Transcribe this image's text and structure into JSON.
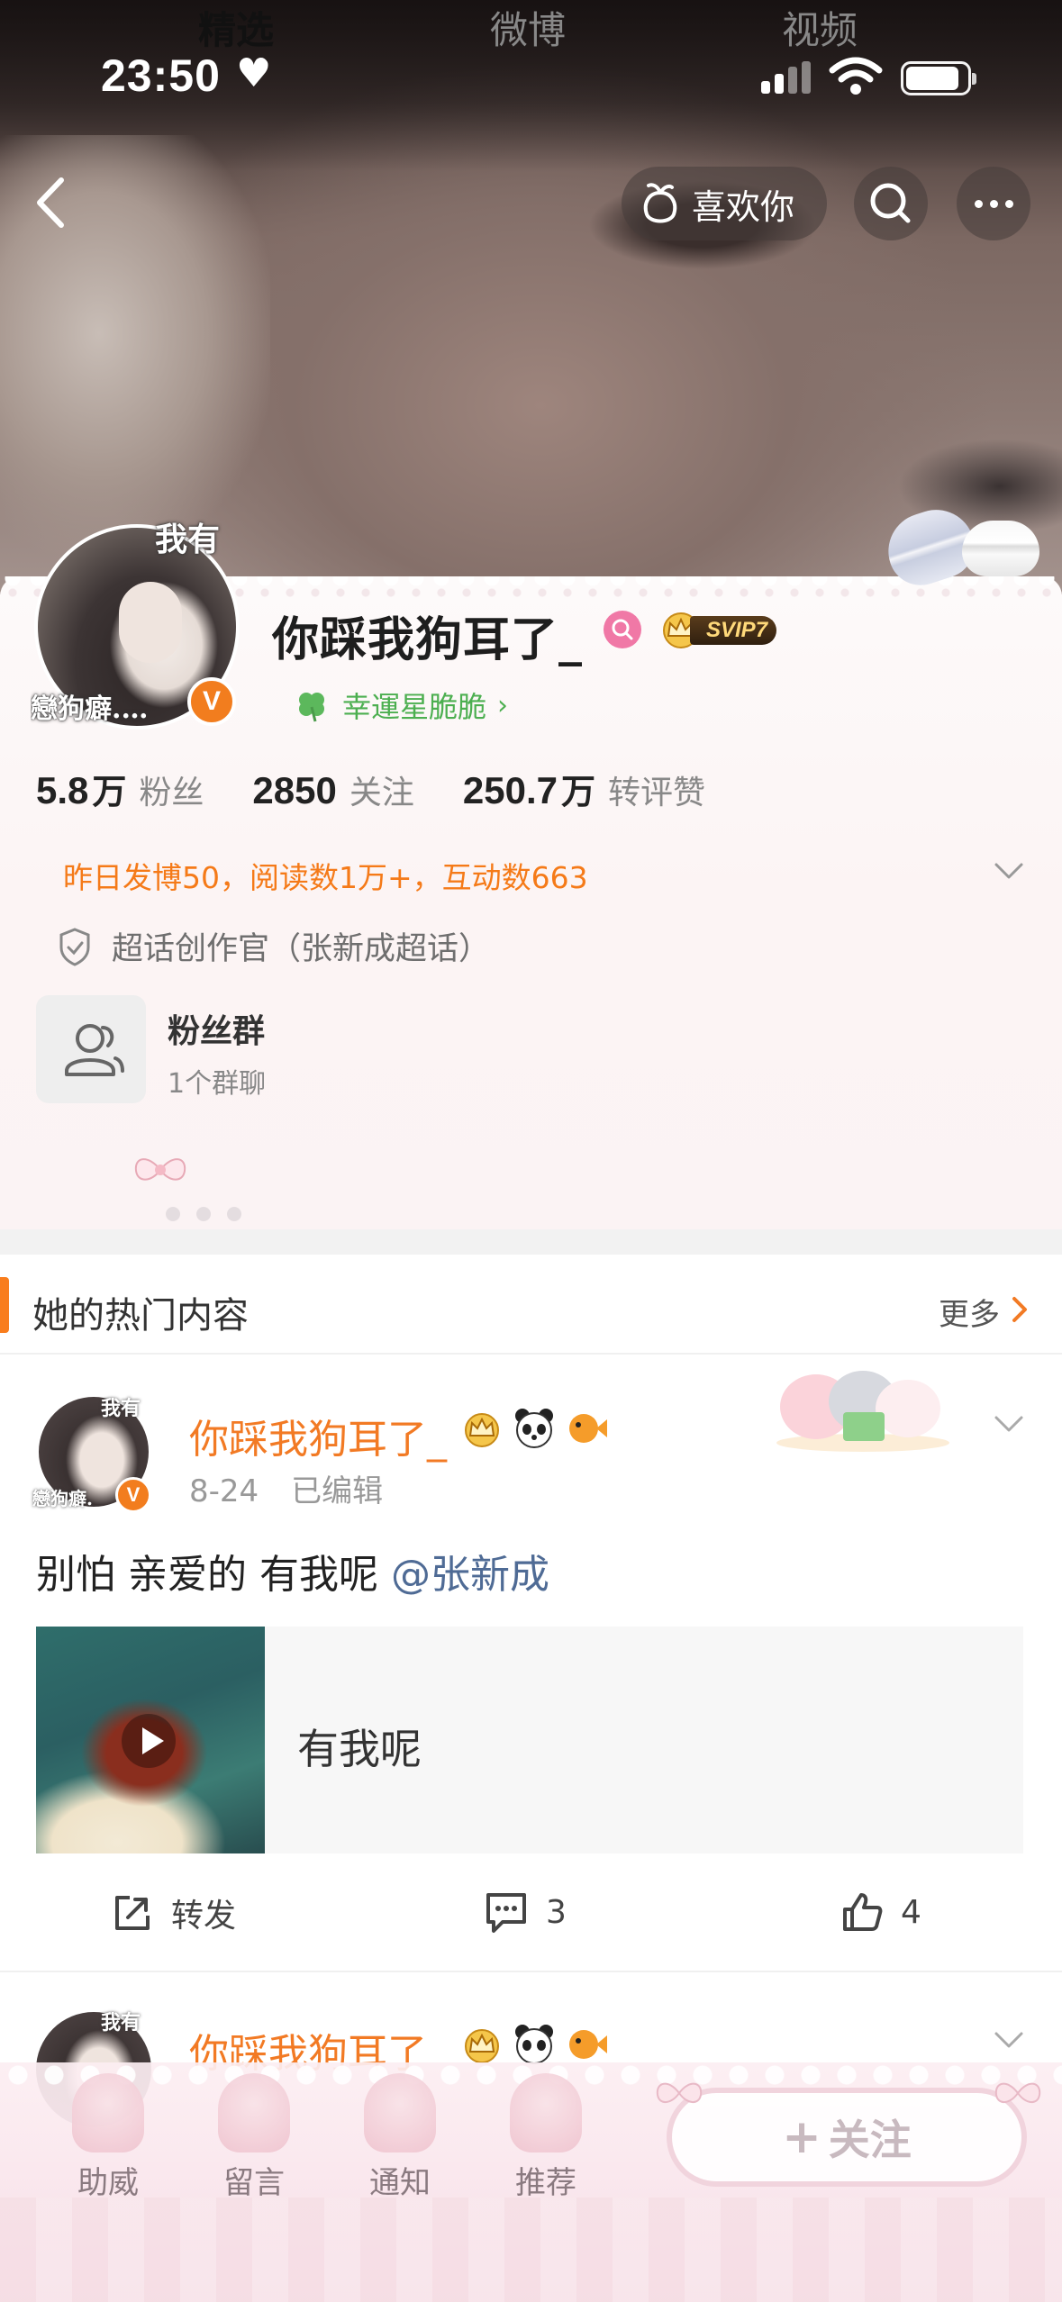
{
  "status_bar": {
    "time": "23:50",
    "heart": "♥",
    "signal": "signal-icon",
    "wifi": "wifi-icon",
    "battery": "battery-icon"
  },
  "top_nav": {
    "back_icon": "chevron-left-icon",
    "like_label": "喜欢你",
    "like_icon": "peach-icon",
    "search_icon": "search-icon",
    "more_icon": "more-icon"
  },
  "profile": {
    "avatar_caption_top": "我有",
    "avatar_caption_bottom": "戀狗癖.…",
    "verified": "V",
    "username": "你踩我狗耳了_",
    "vip_label": "SVIP7",
    "lucky_star": "幸運星脆脆",
    "stats": [
      {
        "num": "5.8",
        "unit": "万",
        "label": "粉丝"
      },
      {
        "num": "2850",
        "unit": "",
        "label": "关注"
      },
      {
        "num": "250.7",
        "unit": "万",
        "label": "转评赞"
      }
    ],
    "summary": "昨日发博50，阅读数1万+，互动数663",
    "super_topic": "超话创作官（张新成超话）",
    "fan_group_title": "粉丝群",
    "fan_group_sub": "1个群聊"
  },
  "tabs": [
    {
      "label": "精选",
      "active": true
    },
    {
      "label": "微博",
      "active": false
    },
    {
      "label": "视频",
      "active": false
    }
  ],
  "hot": {
    "title": "她的热门内容",
    "more": "更多"
  },
  "post": {
    "avatar_caption_top": "我有",
    "avatar_caption_bottom": "戀狗癖.",
    "verified": "V",
    "name": "你踩我狗耳了_",
    "date": "8-24",
    "edited": "已编辑",
    "text": "别怕 亲爱的 有我呢 ",
    "mention": "@张新成",
    "media_title": "有我呢",
    "repost_label": "转发",
    "comments": "3",
    "likes": "4"
  },
  "post2": {
    "avatar_caption_top": "我有",
    "name": "你踩我狗耳了"
  },
  "bottom_bar": {
    "items": [
      "助威",
      "留言",
      "通知",
      "推荐"
    ],
    "follow_label": "关注",
    "follow_plus": "+"
  },
  "colors": {
    "accent_orange": "#f27a24",
    "mention_blue": "#4f6b95",
    "clover_green": "#4caf50",
    "svip_gold": "#ffd97a"
  }
}
